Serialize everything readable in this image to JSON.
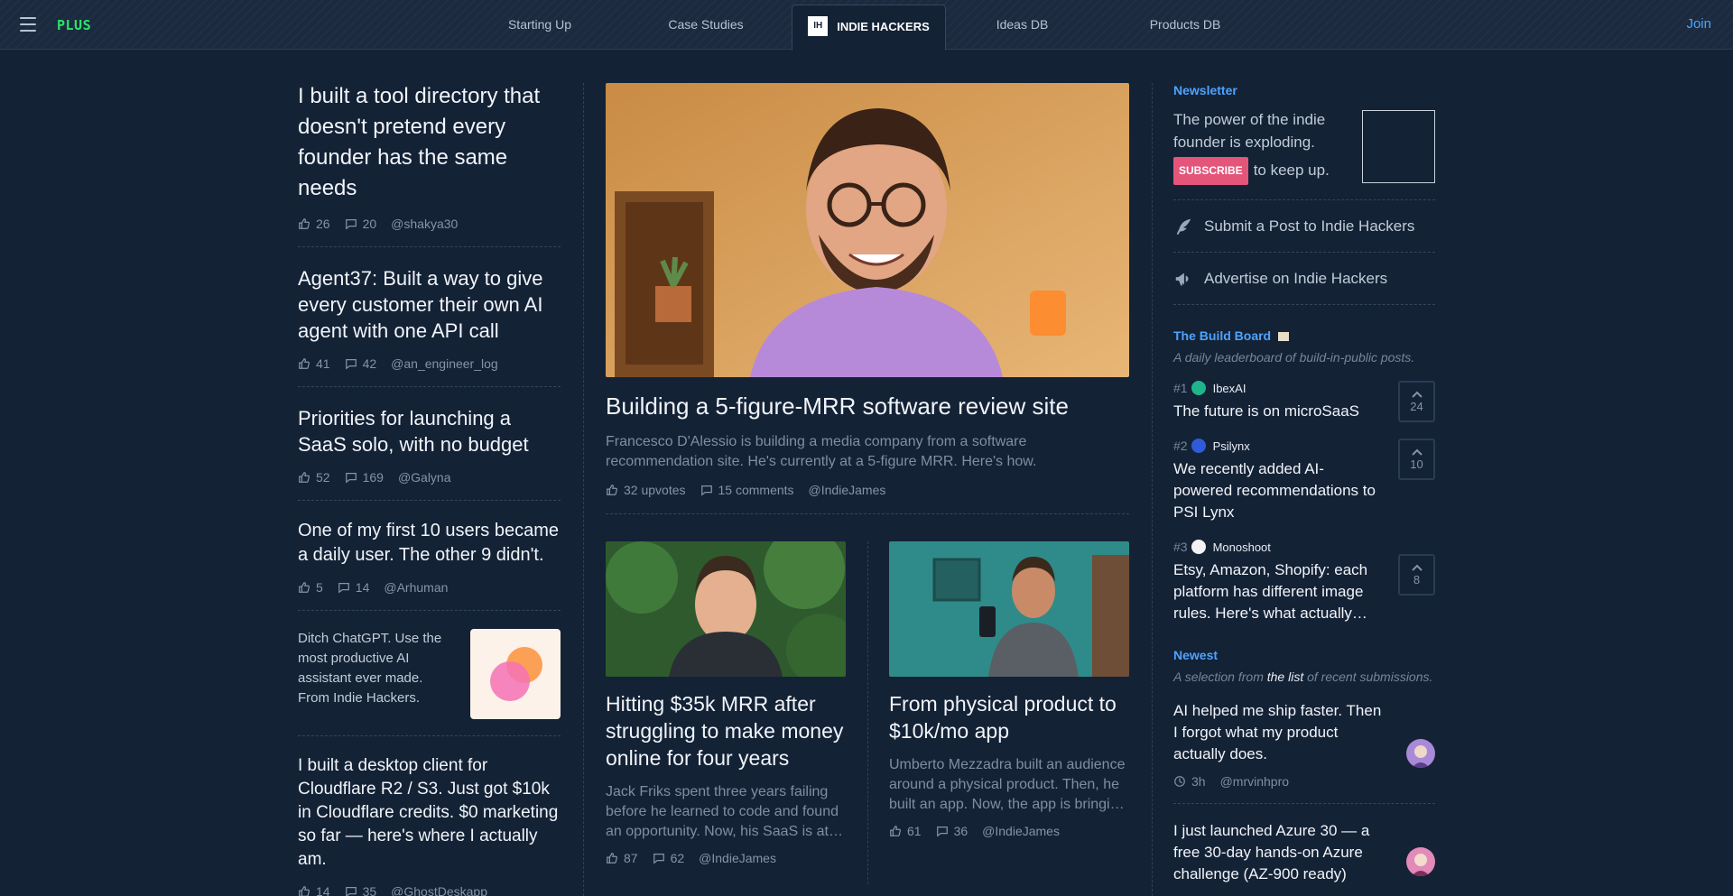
{
  "nav": {
    "logo": "PLUS",
    "tabs": [
      "Starting Up",
      "Case Studies",
      "INDIE HACKERS",
      "Ideas DB",
      "Products DB"
    ],
    "badge": "IH",
    "join": "Join"
  },
  "left_posts": [
    {
      "title": "I built a tool directory that doesn't pretend every founder has the same needs",
      "likes": "26",
      "comments": "20",
      "user": "@shakya30"
    },
    {
      "title": "Agent37: Built a way to give every customer their own AI agent with one API call",
      "likes": "41",
      "comments": "42",
      "user": "@an_engineer_log"
    },
    {
      "title": "Priorities for launching a SaaS solo, with no budget",
      "likes": "52",
      "comments": "169",
      "user": "@Galyna"
    },
    {
      "title": "One of my first 10 users became a daily user. The other 9 didn't.",
      "likes": "5",
      "comments": "14",
      "user": "@Arhuman"
    },
    {
      "title": "I built a desktop client for Cloudflare R2 / S3. Just got $10k in Cloudflare credits. $0 marketing so far — here's where I actually am.",
      "likes": "14",
      "comments": "35",
      "user": "@GhostDeskapp"
    }
  ],
  "ad": {
    "text": "Ditch ChatGPT. Use the most productive AI assistant ever made. From Indie Hackers."
  },
  "featured": {
    "title": "Building a 5-figure-MRR software review site",
    "excerpt": "Francesco D'Alessio is building a media company from a software recommendation site. He's currently at a 5-figure MRR. Here's how.",
    "upvotes": "32 upvotes",
    "comments": "15 comments",
    "user": "@IndieJames"
  },
  "mid_cards": [
    {
      "title": "Hitting $35k MRR after struggling to make money online for four years",
      "excerpt": "Jack Friks spent three years failing before he learned to code and found an opportunity. Now, his SaaS is at…",
      "likes": "87",
      "comments": "62",
      "user": "@IndieJames"
    },
    {
      "title": "From physical product to $10k/mo app",
      "excerpt": "Umberto Mezzadra built an audience around a physical product. Then, he built an app. Now, the app is bringi…",
      "likes": "61",
      "comments": "36",
      "user": "@IndieJames"
    }
  ],
  "newsletter": {
    "heading": "Newsletter",
    "line1": "The power of the indie founder is exploding.",
    "subscribe": "SUBSCRIBE",
    "suffix": "to keep up."
  },
  "actions": {
    "submit": "Submit a Post to Indie Hackers",
    "advertise": "Advertise on Indie Hackers"
  },
  "build_board": {
    "heading": "The Build Board",
    "sub": "A daily leaderboard of build-in-public posts.",
    "items": [
      {
        "rank": "#1",
        "name": "IbexAI",
        "title": "The future is on microSaaS",
        "votes": "24",
        "color": "#1fb58a"
      },
      {
        "rank": "#2",
        "name": "Psilynx",
        "title": "We recently added AI-powered recommendations to PSI Lynx",
        "votes": "10",
        "color": "#2f5bd8"
      },
      {
        "rank": "#3",
        "name": "Monoshoot",
        "title": "Etsy, Amazon, Shopify: each platform has different image rules. Here's what actually…",
        "votes": "8",
        "color": "#f2f2f2"
      }
    ]
  },
  "newest": {
    "heading": "Newest",
    "sub_prefix": "A selection from",
    "sub_link": "the list",
    "sub_suffix": "of recent submissions.",
    "items": [
      {
        "title": "AI helped me ship faster. Then I forgot what my product actually does.",
        "time": "3h",
        "user": "@mrvinhpro"
      },
      {
        "title": "I just launched Azure 30 — a free 30-day hands-on Azure challenge (AZ-900 ready)",
        "time": "",
        "user": ""
      }
    ]
  }
}
